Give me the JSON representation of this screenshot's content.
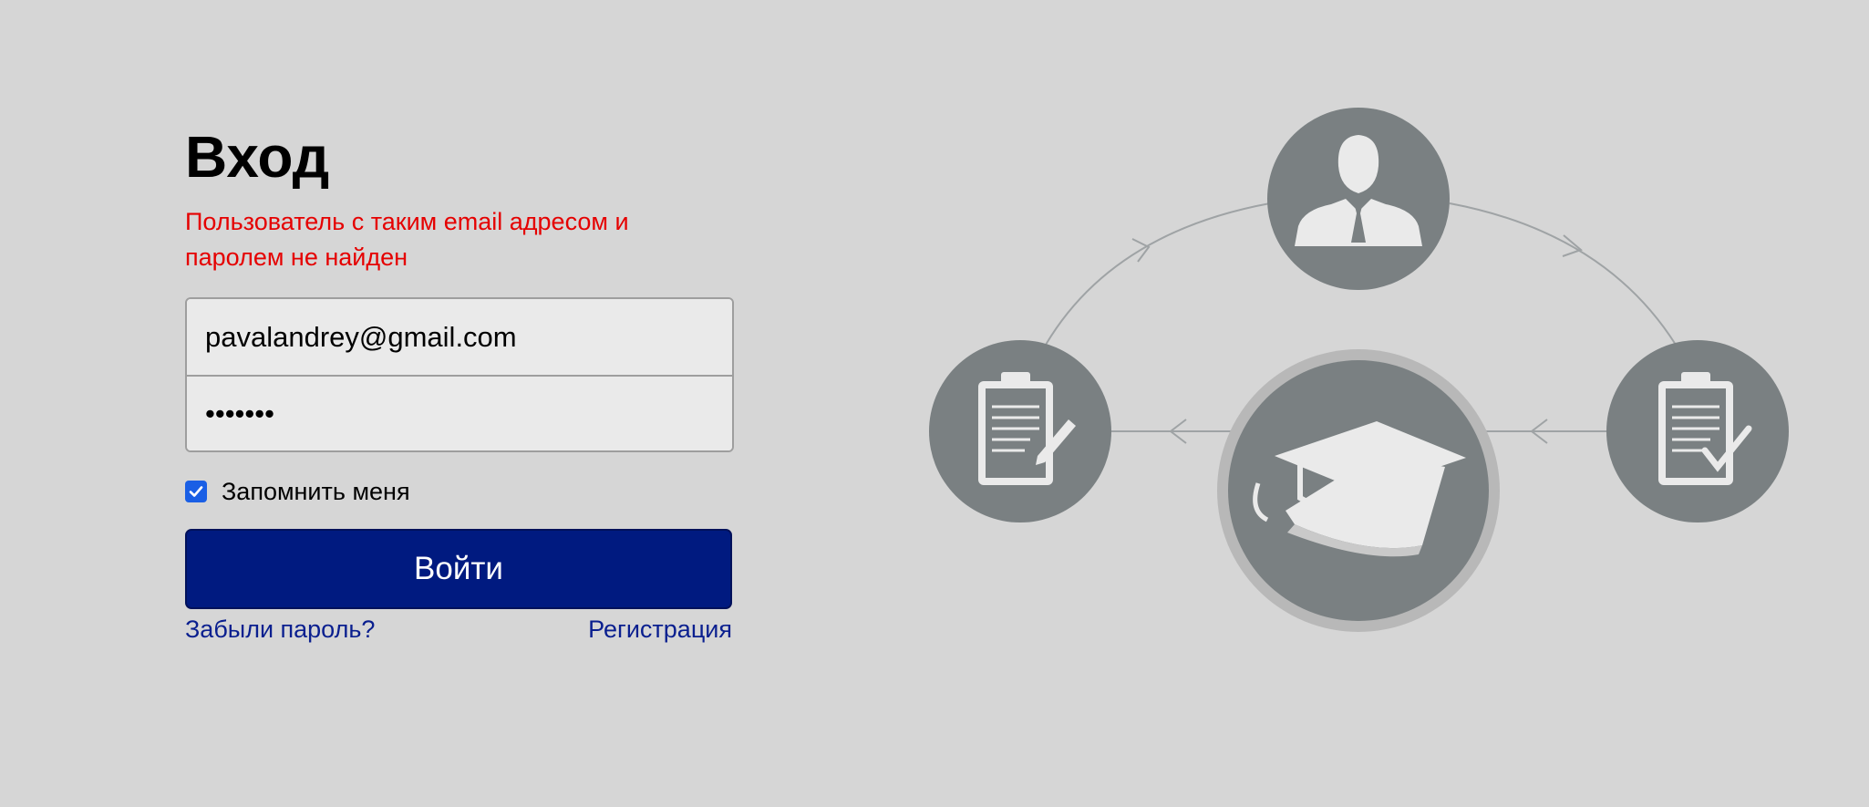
{
  "login": {
    "title": "Вход",
    "error": "Пользователь с таким email адресом и паролем не найден",
    "email_value": "pavalandrey@gmail.com",
    "password_value": "•••••••",
    "remember_label": "Запомнить меня",
    "remember_checked": true,
    "submit_label": "Войти",
    "forgot_link": "Забыли пароль?",
    "register_link": "Регистрация"
  },
  "illustration": {
    "icons": [
      "person-icon",
      "clipboard-edit-icon",
      "graduation-book-icon",
      "clipboard-check-icon"
    ]
  },
  "colors": {
    "background": "#d6d6d6",
    "error": "#e50000",
    "button": "#001a80",
    "link": "#0a1f8f",
    "icon_circle": "#7a8082"
  }
}
